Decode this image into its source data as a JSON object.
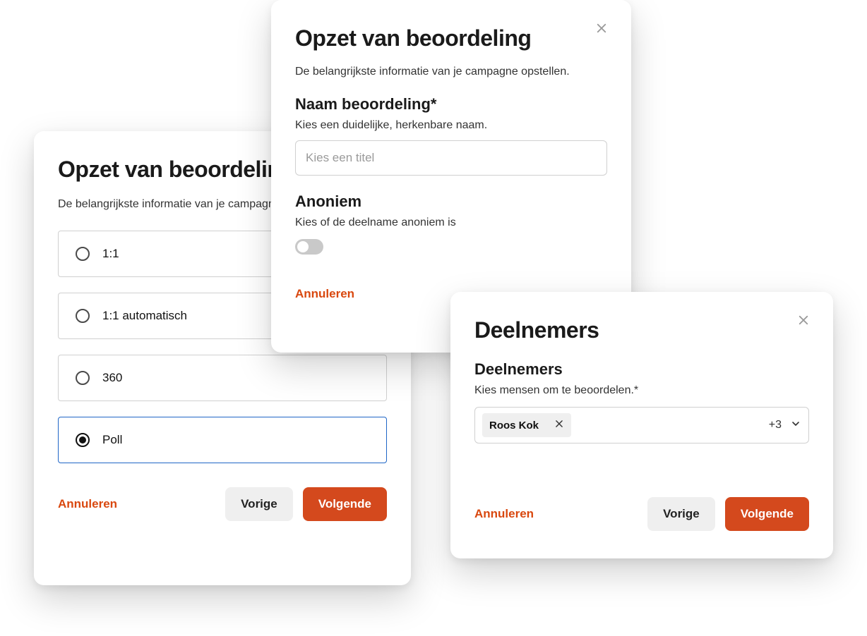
{
  "cardA": {
    "title": "Opzet van beoordeling",
    "subtitle": "De belangrijkste informatie van je campagne opstellen.",
    "options": [
      "1:1",
      "1:1 automatisch",
      "360",
      "Poll"
    ],
    "selected_index": 3,
    "cancel": "Annuleren",
    "prev": "Vorige",
    "next": "Volgende"
  },
  "cardB": {
    "title": "Opzet van beoordeling",
    "subtitle": "De belangrijkste informatie van je campagne opstellen.",
    "name_section": "Naam beoordeling*",
    "name_hint": "Kies een duidelijke, herkenbare naam.",
    "name_placeholder": "Kies een titel",
    "anon_section": "Anoniem",
    "anon_hint": "Kies of de deelname anoniem is",
    "anon_on": false,
    "cancel": "Annuleren"
  },
  "cardC": {
    "title": "Deelnemers",
    "section": "Deelnemers",
    "hint": "Kies mensen om te beoordelen.*",
    "chip_label": "Roos Kok",
    "more_count": "+3",
    "cancel": "Annuleren",
    "prev": "Vorige",
    "next": "Volgende"
  }
}
